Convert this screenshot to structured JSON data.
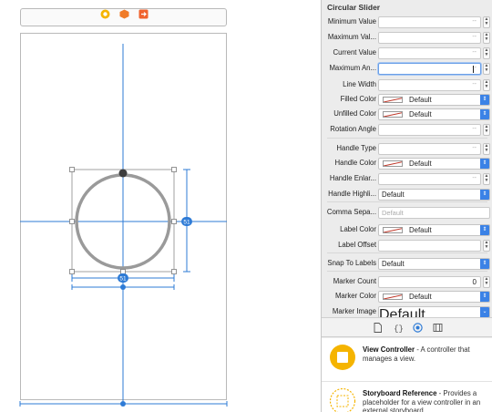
{
  "inspector": {
    "section_title": "Circular Slider",
    "rows": [
      {
        "label": "Minimum Value",
        "kind": "number",
        "value": "--"
      },
      {
        "label": "Maximum Val...",
        "kind": "number",
        "value": "--"
      },
      {
        "label": "Current Value",
        "kind": "number",
        "value": "--"
      },
      {
        "label": "Maximum An...",
        "kind": "number-focus",
        "value": "--"
      },
      {
        "label": "Line Width",
        "kind": "number",
        "value": "--"
      },
      {
        "label": "Filled Color",
        "kind": "color",
        "value": "Default"
      },
      {
        "label": "Unfilled Color",
        "kind": "color",
        "value": "Default"
      },
      {
        "label": "Rotation Angle",
        "kind": "number",
        "value": "--"
      },
      {
        "label": "Handle Type",
        "kind": "number",
        "value": "--"
      },
      {
        "label": "Handle Color",
        "kind": "color",
        "value": "Default"
      },
      {
        "label": "Handle Enlar...",
        "kind": "number",
        "value": "--"
      },
      {
        "label": "Handle Highli...",
        "kind": "popup",
        "value": "Default"
      },
      {
        "label": "Comma Sepa...",
        "kind": "text",
        "value": "Default"
      },
      {
        "label": "Label Color",
        "kind": "color",
        "value": "Default"
      },
      {
        "label": "Label Offset",
        "kind": "number",
        "value": ""
      },
      {
        "label": "Snap To Labels",
        "kind": "popup",
        "value": "Default"
      },
      {
        "label": "Marker Count",
        "kind": "number",
        "value": "0"
      },
      {
        "label": "Marker Color",
        "kind": "color",
        "value": "Default"
      },
      {
        "label": "Marker Image",
        "kind": "image",
        "value": "Default"
      }
    ],
    "tab_icons": [
      "file-inspector-icon",
      "code-braces-icon",
      "object-library-icon",
      "media-library-icon"
    ]
  },
  "library": {
    "items": [
      {
        "title": "View Controller",
        "description": " - A controller that manages a view.",
        "icon": "view-controller-icon"
      },
      {
        "title": "Storyboard Reference",
        "description": " - Provides a placeholder for a view controller in an external storyboard.",
        "icon": "storyboard-reference-icon"
      }
    ]
  },
  "canvas": {
    "scene_icons": [
      "first-responder-icon",
      "view-controller-scene-icon",
      "exit-icon"
    ],
    "constraint_badges": [
      "51",
      "51"
    ],
    "colors": {
      "constraint": "#2e7bd6",
      "ring": "#9a9a9a",
      "handle": "#3d3d3d",
      "accent": "#3b82e6"
    }
  }
}
